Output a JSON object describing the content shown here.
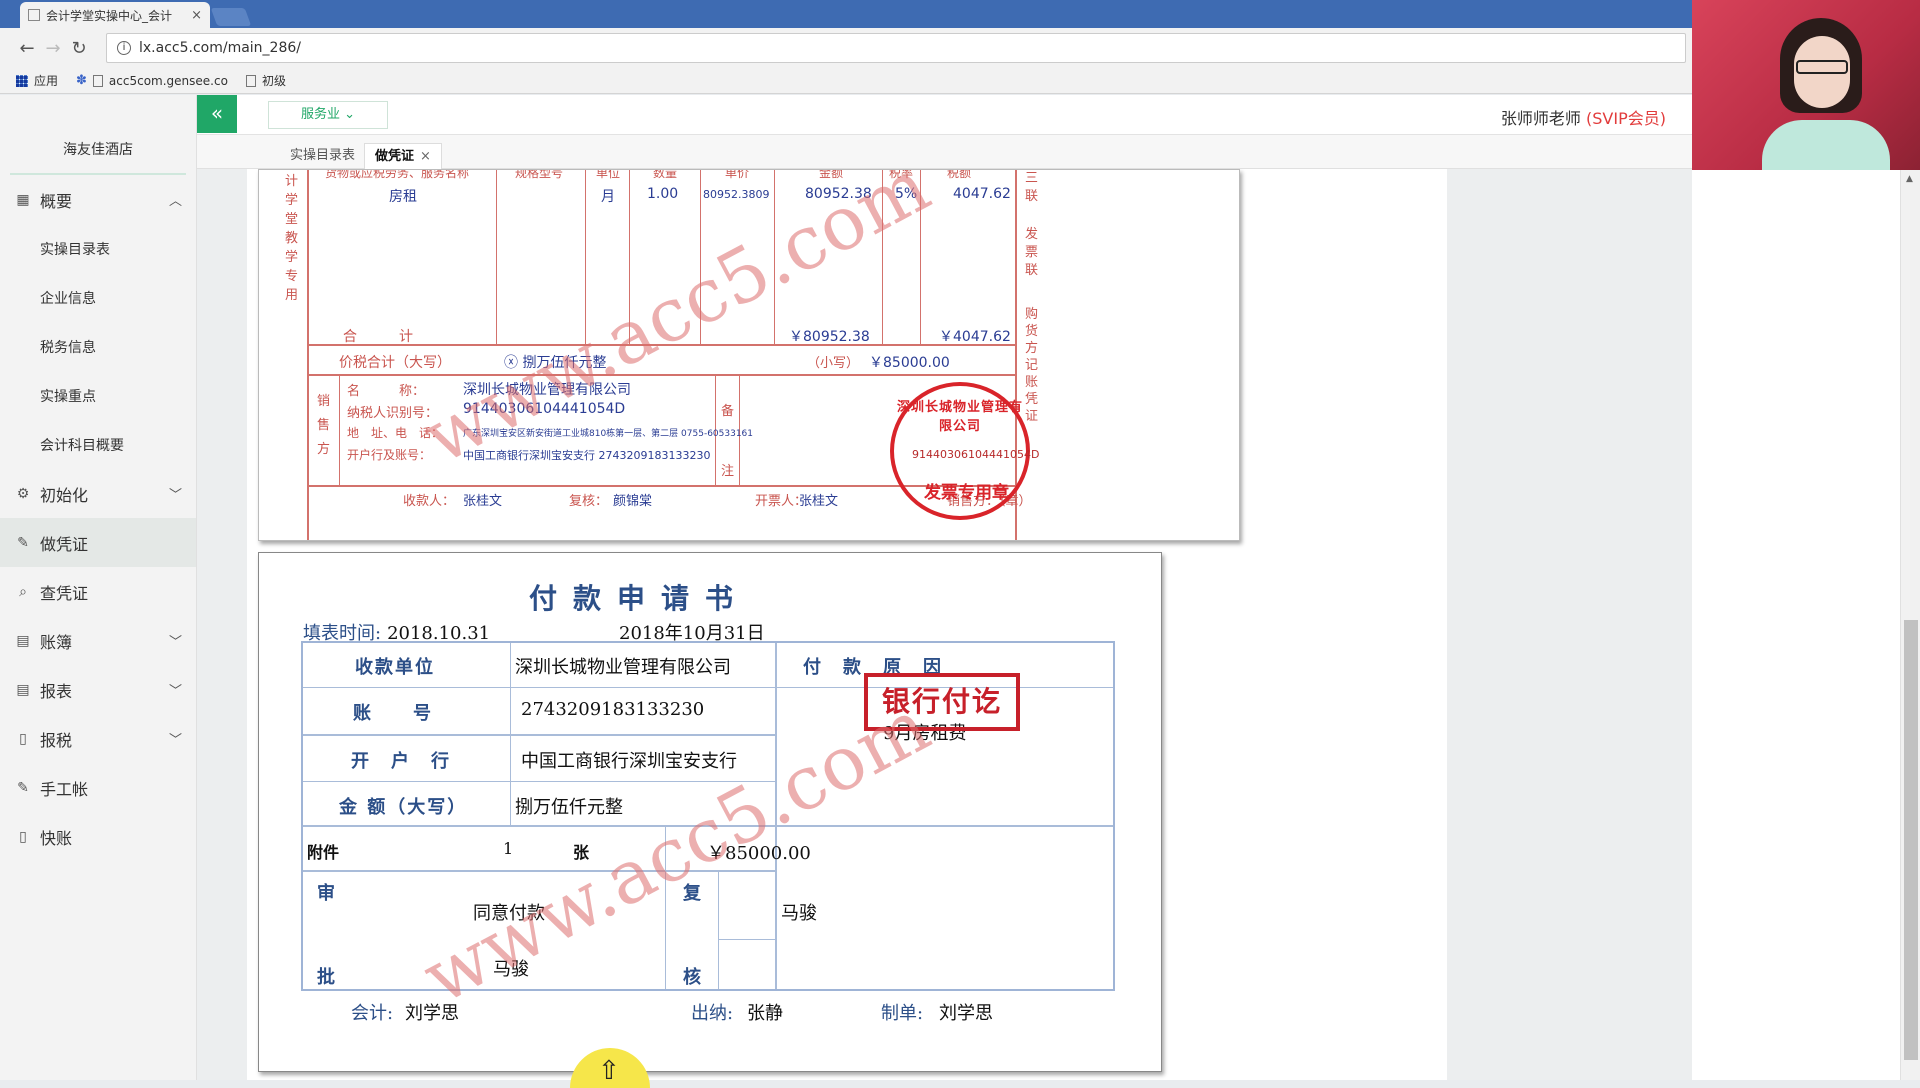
{
  "browser": {
    "tab_title": "会计学堂实操中心_会计",
    "url": "lx.acc5.com/main_286/",
    "bookmarks": [
      "应用",
      "acc5com.gensee.co",
      "初级"
    ]
  },
  "header": {
    "collapse_icon": "«",
    "industry_label": "服务业",
    "user_name": "张师师老师",
    "user_badge": "(SVIP会员)"
  },
  "sidebar": {
    "company": "海友佳酒店",
    "items": [
      {
        "label": "概要",
        "icon": "overview-icon",
        "glyph": "▦",
        "chevron": "︿"
      },
      {
        "label": "实操目录表",
        "sub": true
      },
      {
        "label": "企业信息",
        "sub": true
      },
      {
        "label": "税务信息",
        "sub": true
      },
      {
        "label": "实操重点",
        "sub": true
      },
      {
        "label": "会计科目概要",
        "sub": true
      },
      {
        "label": "初始化",
        "icon": "gear-icon",
        "glyph": "⚙",
        "chevron": "﹀"
      },
      {
        "label": "做凭证",
        "icon": "pen-icon",
        "glyph": "✎",
        "active": true
      },
      {
        "label": "查凭证",
        "icon": "search-icon",
        "glyph": "⌕"
      },
      {
        "label": "账簿",
        "icon": "book-icon",
        "glyph": "▤",
        "chevron": "﹀"
      },
      {
        "label": "报表",
        "icon": "report-icon",
        "glyph": "▤",
        "chevron": "﹀"
      },
      {
        "label": "报税",
        "icon": "file-icon",
        "glyph": "▯",
        "chevron": "﹀"
      },
      {
        "label": "手工帐",
        "icon": "pen-icon",
        "glyph": "✎"
      },
      {
        "label": "快账",
        "icon": "file-icon",
        "glyph": "▯"
      }
    ]
  },
  "tabs": [
    {
      "label": "实操目录表"
    },
    {
      "label": "做凭证",
      "close": "×"
    }
  ],
  "invoice": {
    "header_cols": [
      "货物或应税劳务、服务名称",
      "规格型号",
      "单位",
      "数量",
      "单价",
      "金额",
      "税率",
      "税额"
    ],
    "item_name": "房租",
    "unit": "月",
    "qty": "1.00",
    "price": "80952.3809",
    "amount": "80952.38",
    "rate": "5%",
    "tax": "4047.62",
    "total_label": "合　　　计",
    "total_amount": "￥80952.38",
    "total_tax": "￥4047.62",
    "sum_label": "价税合计（大写）",
    "sum_upper": "ⓧ 捌万伍仟元整",
    "sum_small_label": "（小写）",
    "sum_small": "￥85000.00",
    "left_vertical": "计学堂教学专用",
    "right_vertical_1": "三联",
    "right_vertical_2": "发票联",
    "right_vertical_3": "购货方记账凭证",
    "seller_label": "销售方",
    "remark_label": "备注",
    "seller_name_label": "名　　　称：",
    "seller_name": "深圳长城物业管理有限公司",
    "seller_taxid_label": "纳税人识别号：",
    "seller_taxid": "91440306104441054D",
    "seller_addr_label": "地　址、电　话：",
    "seller_addr": "广东深圳宝安区新安街道工业城810栋第一层、第二层 0755-60533161",
    "seller_bank_label": "开户行及账号：",
    "seller_bank": "中国工商银行深圳宝安支行 2743209183133230",
    "payee_label": "收款人：",
    "payee": "张桂文",
    "reviewer_label": "复核：",
    "reviewer": "颜锦棠",
    "drawer_label": "开票人：",
    "drawer": "张桂文",
    "seller_sign": "销售方：（章）",
    "seal_top": "深圳长城物业管理有限公司",
    "seal_code": "91440306104441054D",
    "seal_bottom": "发票专用章"
  },
  "payform": {
    "title": "付款申请书",
    "date_label": "填表时间:",
    "date_value": "2018.10.31",
    "date_cn": "2018年10月31日",
    "payee_label": "收款单位",
    "payee": "深圳长城物业管理有限公司",
    "reason_label": "付　款　原　因",
    "account_label": "账　　号",
    "account": "2743209183133230",
    "reason": "9月房租费",
    "bank_label": "开　户　行",
    "bank": "中国工商银行深圳宝安支行",
    "amount_label": "金 额（大写）",
    "amount_upper": "捌万伍仟元整",
    "attach_label": "附件",
    "attach_count": "1",
    "attach_unit": "张",
    "amount_small": "￥85000.00",
    "approve_top": "审",
    "approve_bottom": "批",
    "approve_text": "同意付款",
    "approve_person": "马骏",
    "review_top": "复",
    "review_bottom": "核",
    "review_person": "马骏",
    "stamp": "银行付讫",
    "accountant_label": "会计:",
    "accountant": "刘学思",
    "cashier_label": "出纳:",
    "cashier": "张静",
    "maker_label": "制单:",
    "maker": "刘学思"
  },
  "watermark": "www.acc5.com"
}
